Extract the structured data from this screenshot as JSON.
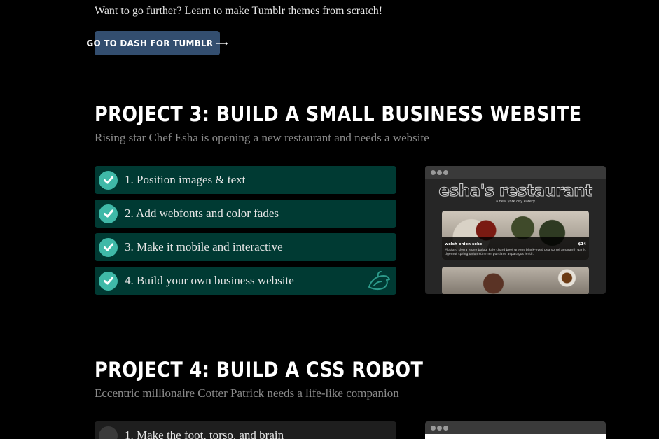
{
  "intro": {
    "text": "Want to go further? Learn to make Tumblr themes from scratch!",
    "button_label": "GO TO DASH FOR TUMBLR",
    "button_arrow": "⟶"
  },
  "project3": {
    "title": "PROJECT 3: BUILD A SMALL BUSINESS WEBSITE",
    "subtitle": "Rising star Chef Esha is opening a new restaurant and needs a website",
    "steps": [
      {
        "label": "1. Position images & text",
        "status": "complete"
      },
      {
        "label": "2. Add webfonts and color fades",
        "status": "complete"
      },
      {
        "label": "3. Make it mobile and interactive",
        "status": "complete"
      },
      {
        "label": "4. Build your own business website",
        "status": "complete",
        "icon": "bird-icon"
      }
    ],
    "preview": {
      "site_name": "esha's restaurant",
      "tagline": "a new york city eatery",
      "dish": "welsh onion soko",
      "price": "$14",
      "description": "Mustard sierra leone bologi kale chard beet greens black-eyed pea sorrel amaranth garlic tigernut spring onion summer purslane asparagus lentil."
    }
  },
  "project4": {
    "title": "PROJECT 4: BUILD A CSS ROBOT",
    "subtitle": "Eccentric millionaire Cotter Patrick needs a life-like companion",
    "steps": [
      {
        "label": "1. Make the foot, torso, and brain",
        "status": "incomplete"
      }
    ]
  },
  "colors": {
    "background": "#000000",
    "button": "#334e6f",
    "step_complete_bg": "#003a33",
    "check_circle": "#3fb9a8",
    "subtitle": "#8a8a8a"
  }
}
